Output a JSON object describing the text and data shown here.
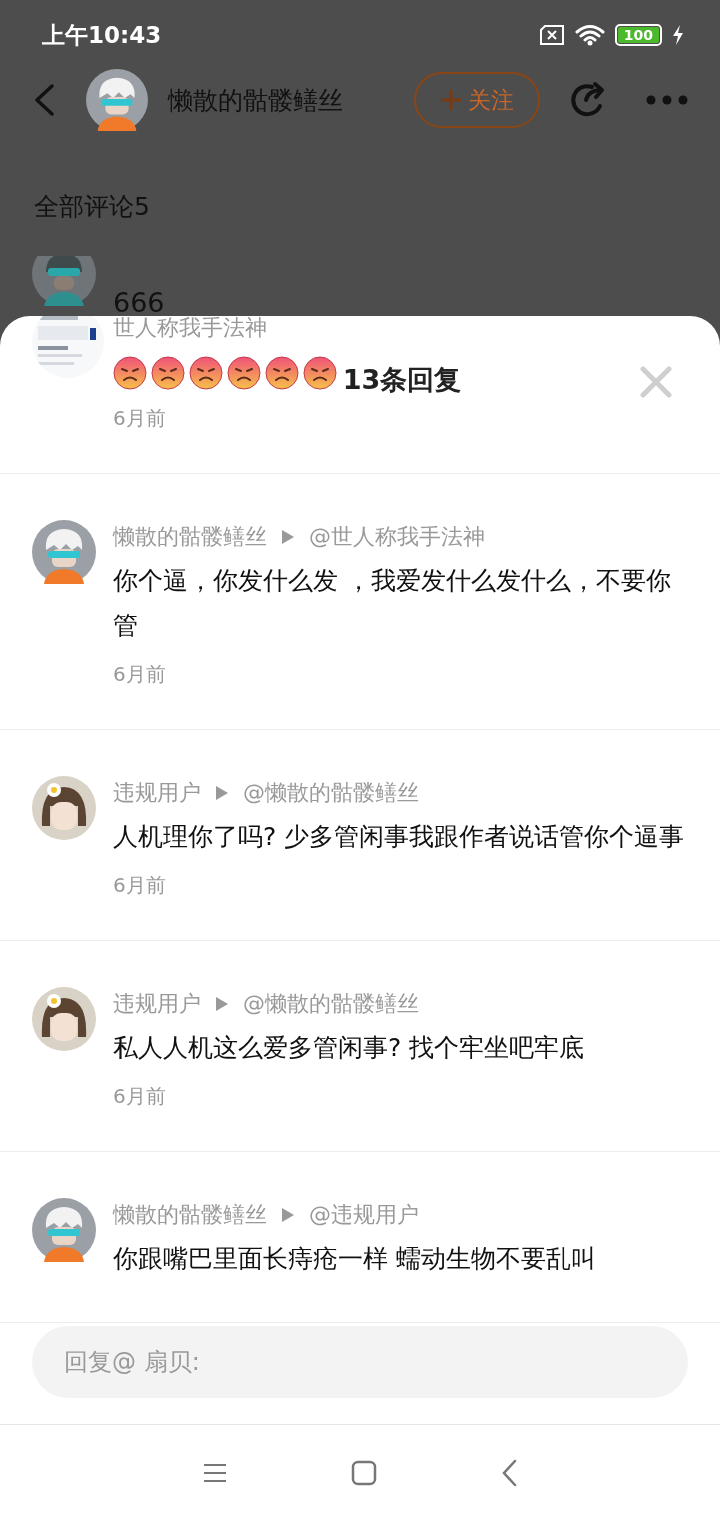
{
  "status_bar": {
    "time": "上午10:43",
    "battery": "100"
  },
  "header": {
    "username": "懒散的骷髅鳝丝",
    "follow_button": "关注"
  },
  "comments_heading": "全部评论5",
  "background_comment": {
    "text": "666"
  },
  "replies_sheet": {
    "title": "13条回复",
    "parent": {
      "author": "世人称我手法神",
      "reactions": [
        {
          "kind": "angry"
        },
        {
          "kind": "angry"
        },
        {
          "kind": "angry"
        },
        {
          "kind": "angry"
        },
        {
          "kind": "angry"
        },
        {
          "kind": "angry"
        }
      ],
      "time": "6月前"
    },
    "replies": [
      {
        "kind": "skull",
        "author": "懒散的骷髅鳝丝",
        "target": "@世人称我手法神",
        "text": "你个逼，你发什么发 ，我爱发什么发什么，不要你管",
        "time": "6月前"
      },
      {
        "kind": "flower",
        "author": "违规用户",
        "target": "@懒散的骷髅鳝丝",
        "text": "人机理你了吗? 少多管闲事我跟作者说话管你个逼事",
        "time": "6月前"
      },
      {
        "kind": "flower",
        "author": "违规用户",
        "target": "@懒散的骷髅鳝丝",
        "text": "私人人机这么爱多管闲事? 找个牢坐吧牢底",
        "time": "6月前"
      },
      {
        "kind": "skull",
        "author": "懒散的骷髅鳝丝",
        "target": "@违规用户",
        "text": "你跟嘴巴里面长痔疮一样 蠕动生物不要乱叫"
      }
    ],
    "reply_field": {
      "placeholder": "回复@ 扇贝:"
    }
  }
}
